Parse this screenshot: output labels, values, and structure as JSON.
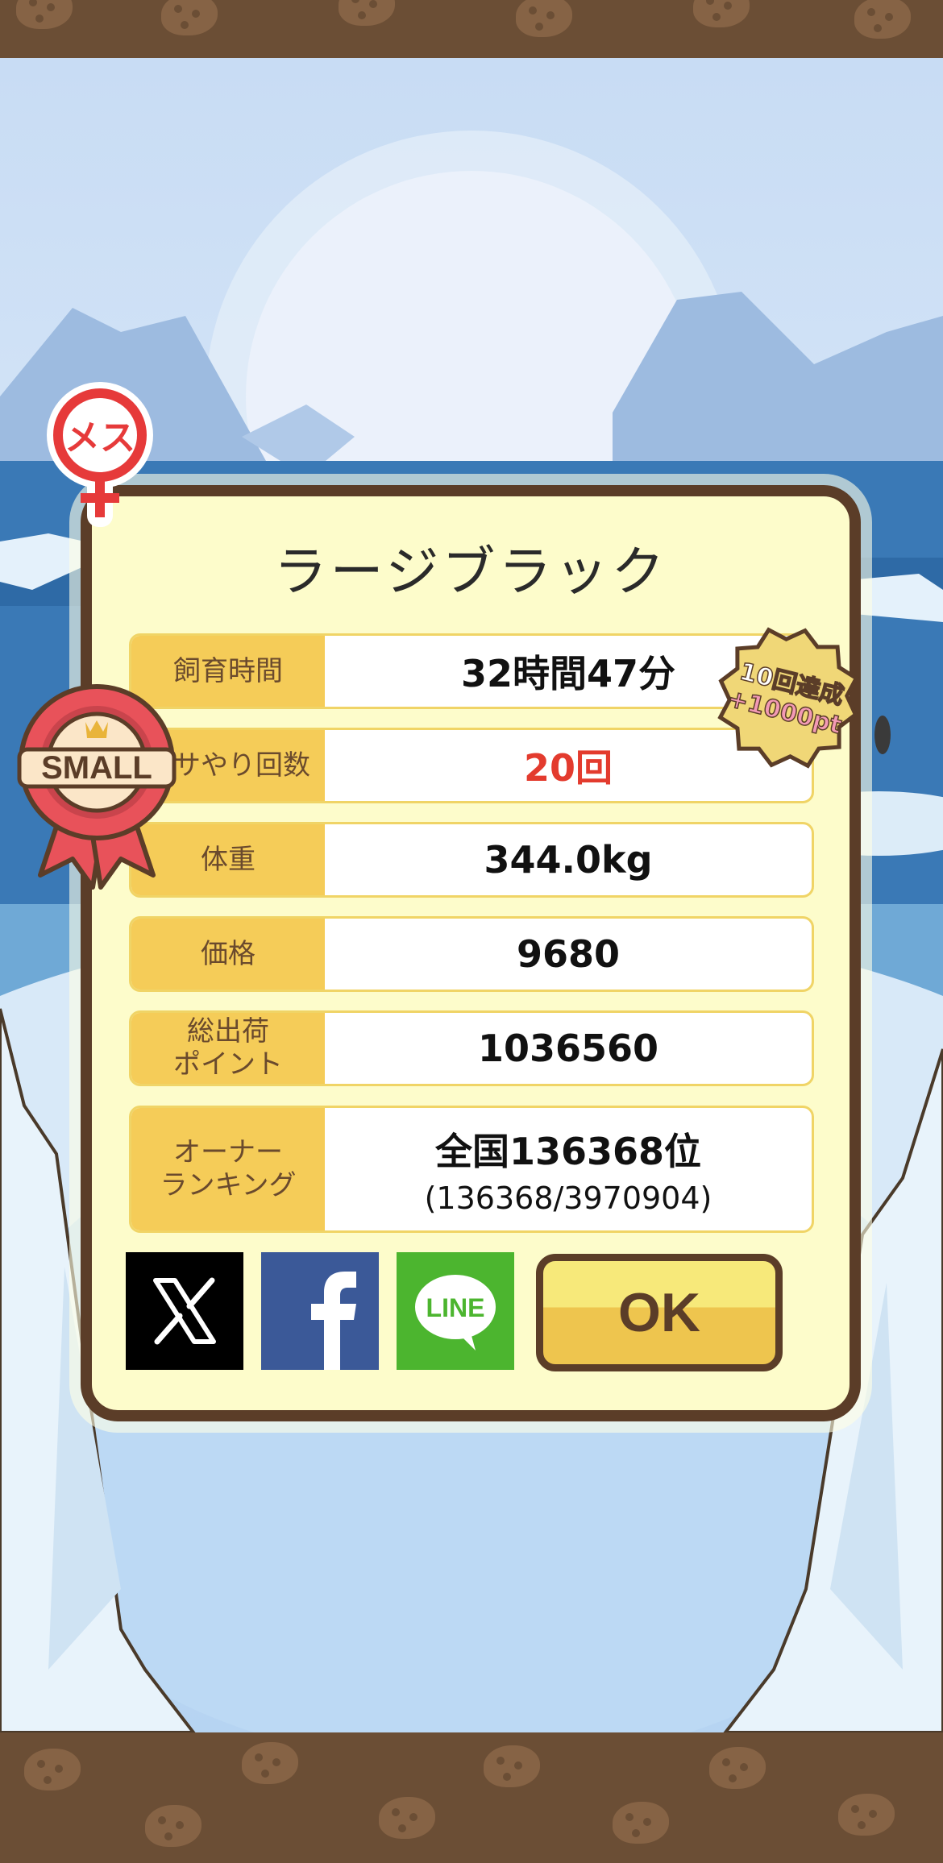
{
  "title": "ラージブラック",
  "gender_badge": {
    "label": "メス"
  },
  "rank_ribbon": {
    "label": "SMALL"
  },
  "achievement_badge": {
    "line1": "10回達成",
    "line2": "+1000pt"
  },
  "stats": [
    {
      "label": "飼育時間",
      "value": "32時間47分",
      "highlight": false
    },
    {
      "label": "エサやり回数",
      "value": "20回",
      "highlight": true
    },
    {
      "label": "体重",
      "value": "344.0kg",
      "highlight": false
    },
    {
      "label": "価格",
      "value": "9680",
      "highlight": false
    },
    {
      "label": "総出荷\nポイント",
      "value": "1036560",
      "highlight": false
    }
  ],
  "ranking": {
    "label": "オーナー\nランキング",
    "value": "全国136368位",
    "detail": "(136368/3970904)"
  },
  "share": {
    "x": "X",
    "facebook": "f",
    "line": "LINE"
  },
  "ok_label": "OK",
  "colors": {
    "panel_bg": "#fdfccb",
    "frame": "#5b3d28",
    "label_bg": "#f5cc58",
    "highlight": "#e33b2e"
  }
}
